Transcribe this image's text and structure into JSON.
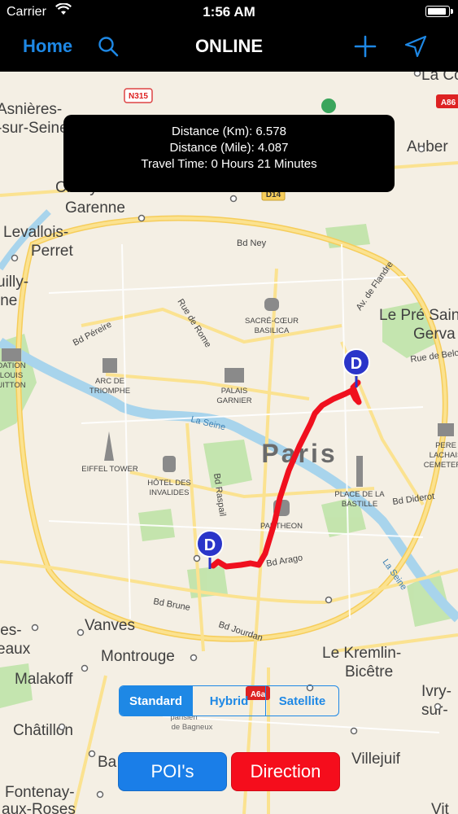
{
  "status_bar": {
    "carrier": "Carrier",
    "time": "1:56 AM",
    "battery_level": 1.0
  },
  "nav": {
    "home": "Home",
    "title": "ONLINE",
    "search_icon": "search-icon",
    "add_icon": "plus-icon",
    "locate_icon": "location-arrow-icon"
  },
  "info": {
    "distance_km": "Distance (Km): 6.578",
    "distance_mile": "Distance (Mile): 4.087",
    "travel_time": "Travel Time: 0 Hours 21 Minutes"
  },
  "map_type": {
    "options": [
      "Standard",
      "Hybrid",
      "Satellite"
    ],
    "selected": "Standard"
  },
  "actions": {
    "pois": "POI's",
    "direction": "Direction"
  },
  "colors": {
    "accent": "#1e88e5",
    "route": "#f0101e",
    "direction_button": "#f50d1c",
    "poi_button": "#1a7ee8",
    "marker": "#2a35c9"
  },
  "map": {
    "city": "Paris",
    "markers": [
      {
        "letter": "D"
      },
      {
        "letter": "D"
      }
    ],
    "road_shields": [
      "N315",
      "D14",
      "A86",
      "A6a"
    ],
    "roads": [
      "Bd Ney",
      "Bd Péreire",
      "Rue de Rome",
      "Av. de Flandre",
      "Rue de Belle",
      "La Seine",
      "Bd Raspail",
      "Bd Arago",
      "Bd Diderot",
      "Bd Brune",
      "Bd Jourdan"
    ],
    "places": [
      "Asnières-sur-Seine",
      "Clichy-la-Saint-Ouen",
      "Garenne",
      "Levallois-Perret",
      "Neuilly-sur-Seine",
      "Aubervilliers",
      "Le Pré Saint-Gervais",
      "Vanves",
      "Montrouge",
      "Malakoff",
      "Châtillon",
      "Fontenay-aux-Roses",
      "Le Kremlin-Bicêtre",
      "Ivry-sur-Seine",
      "Villejuif",
      "Issy-les-Moulineaux",
      "Bagneux",
      "Parisien de Bagneux",
      "La Courneuve"
    ],
    "landmarks": [
      "SACRÉ-CŒUR BASILICA",
      "ARC DE TRIOMPHE",
      "PALAIS GARNIER",
      "EIFFEL TOWER",
      "HÔTEL DES INVALIDES",
      "PANTHEON",
      "PLACE DE LA BASTILLE",
      "PÈRE LACHAISE CEMETERY",
      "FONDATION LOUIS VUITTON"
    ]
  }
}
